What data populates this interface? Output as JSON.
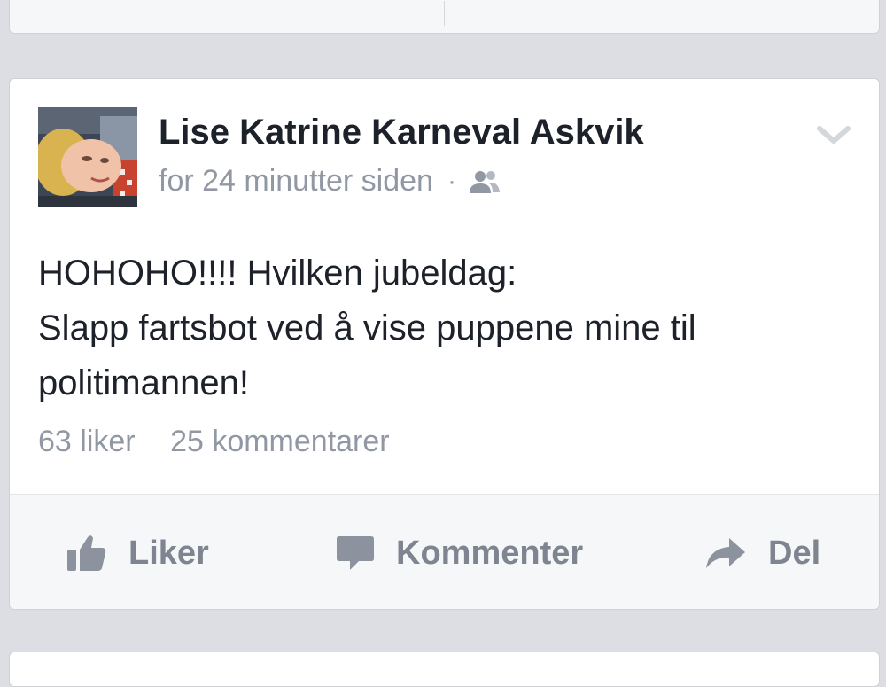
{
  "post": {
    "author": "Lise Katrine Karneval Askvik",
    "timestamp": "for 24 minutter siden",
    "separator": "·",
    "audience_icon": "friends-icon",
    "menu_icon": "chevron-down-icon",
    "text_lines": [
      "HOHOHO!!!! Hvilken jubeldag:",
      "Slapp fartsbot ved å vise puppene mine til",
      "politimannen!"
    ],
    "likes": "63 liker",
    "comments": "25 kommentarer"
  },
  "actions": {
    "like_label": "Liker",
    "comment_label": "Kommenter",
    "share_label": "Del"
  },
  "colors": {
    "background": "#dcdee3",
    "card": "#ffffff",
    "text": "#1d2129",
    "muted": "#9197a3",
    "action": "#7f8590"
  }
}
